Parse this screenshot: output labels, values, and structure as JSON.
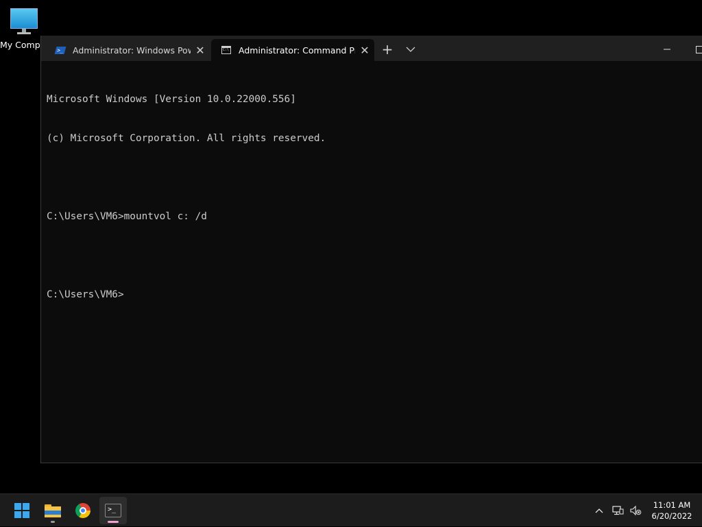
{
  "desktop": {
    "icons": [
      {
        "label": "My Compu",
        "icon": "computer-icon"
      }
    ]
  },
  "terminal": {
    "tabs": [
      {
        "title": "Administrator: Windows PowerS",
        "icon": "powershell-icon",
        "active": false
      },
      {
        "title": "Administrator: Command Promp",
        "icon": "cmd-icon",
        "active": true
      }
    ],
    "new_tab_glyph": "+",
    "close_glyph": "✕",
    "console_lines": [
      "Microsoft Windows [Version 10.0.22000.556]",
      "(c) Microsoft Corporation. All rights reserved.",
      "",
      "C:\\Users\\VM6>mountvol c: /d",
      "",
      "C:\\Users\\VM6>"
    ],
    "colors": {
      "background": "#0c0c0c",
      "text": "#cccccc",
      "tabbar": "#202020"
    }
  },
  "taskbar": {
    "apps": [
      {
        "name": "start",
        "icon": "windows-start-icon"
      },
      {
        "name": "file-explorer",
        "icon": "folder-icon"
      },
      {
        "name": "chrome",
        "icon": "chrome-icon"
      },
      {
        "name": "windows-terminal",
        "icon": "terminal-icon",
        "active": true
      }
    ],
    "tray_icons": [
      "chevron-up-icon",
      "network-icon",
      "volume-muted-icon"
    ],
    "clock": {
      "time": "11:01 AM",
      "date": "6/20/2022"
    }
  }
}
